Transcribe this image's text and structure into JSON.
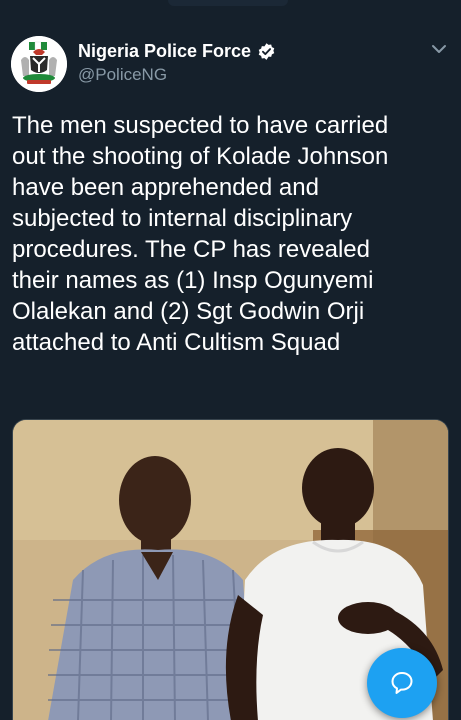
{
  "tweet": {
    "author": {
      "name": "Nigeria Police Force",
      "handle": "@PoliceNG",
      "verified": true,
      "avatar_icon": "nigeria-coat-of-arms-icon"
    },
    "text": "The men suspected to have carried\nout the shooting of Kolade Johnson\nhave been apprehended and\nsubjected to internal disciplinary\nprocedures. The CP has revealed\ntheir names as (1) Insp Ogunyemi\nOlalekan and (2) Sgt Godwin Orji\nattached to Anti Cultism Squad",
    "media": {
      "type": "photo",
      "description_icon": "photo-two-men-icon"
    },
    "menu_icon": "chevron-down-icon"
  },
  "fab": {
    "icon": "reply-bubble-icon"
  },
  "colors": {
    "background": "#15202b",
    "text": "#ffffff",
    "secondary_text": "#8899a6",
    "accent": "#1da1f2",
    "border": "#38444d"
  }
}
